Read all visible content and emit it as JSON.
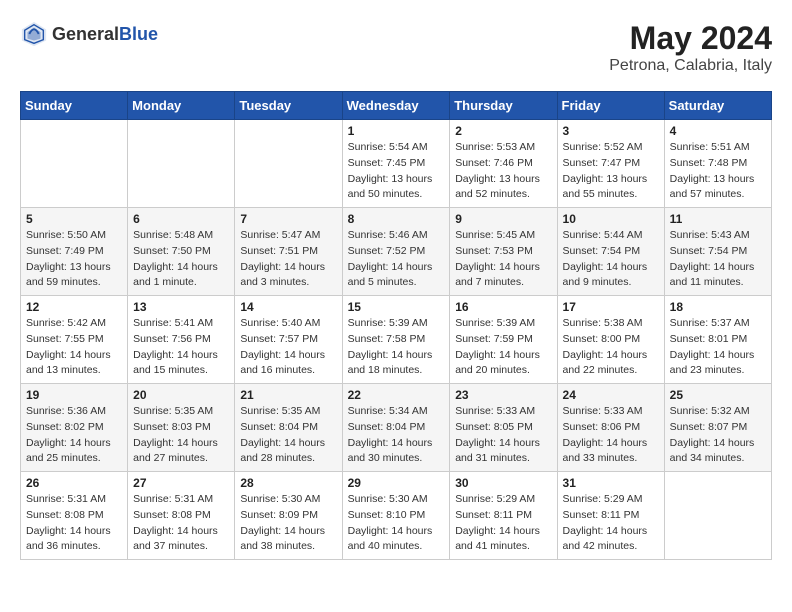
{
  "header": {
    "logo_general": "General",
    "logo_blue": "Blue",
    "month": "May 2024",
    "location": "Petrona, Calabria, Italy"
  },
  "weekdays": [
    "Sunday",
    "Monday",
    "Tuesday",
    "Wednesday",
    "Thursday",
    "Friday",
    "Saturday"
  ],
  "weeks": [
    [
      {
        "day": "",
        "info": ""
      },
      {
        "day": "",
        "info": ""
      },
      {
        "day": "",
        "info": ""
      },
      {
        "day": "1",
        "info": "Sunrise: 5:54 AM\nSunset: 7:45 PM\nDaylight: 13 hours\nand 50 minutes."
      },
      {
        "day": "2",
        "info": "Sunrise: 5:53 AM\nSunset: 7:46 PM\nDaylight: 13 hours\nand 52 minutes."
      },
      {
        "day": "3",
        "info": "Sunrise: 5:52 AM\nSunset: 7:47 PM\nDaylight: 13 hours\nand 55 minutes."
      },
      {
        "day": "4",
        "info": "Sunrise: 5:51 AM\nSunset: 7:48 PM\nDaylight: 13 hours\nand 57 minutes."
      }
    ],
    [
      {
        "day": "5",
        "info": "Sunrise: 5:50 AM\nSunset: 7:49 PM\nDaylight: 13 hours\nand 59 minutes."
      },
      {
        "day": "6",
        "info": "Sunrise: 5:48 AM\nSunset: 7:50 PM\nDaylight: 14 hours\nand 1 minute."
      },
      {
        "day": "7",
        "info": "Sunrise: 5:47 AM\nSunset: 7:51 PM\nDaylight: 14 hours\nand 3 minutes."
      },
      {
        "day": "8",
        "info": "Sunrise: 5:46 AM\nSunset: 7:52 PM\nDaylight: 14 hours\nand 5 minutes."
      },
      {
        "day": "9",
        "info": "Sunrise: 5:45 AM\nSunset: 7:53 PM\nDaylight: 14 hours\nand 7 minutes."
      },
      {
        "day": "10",
        "info": "Sunrise: 5:44 AM\nSunset: 7:54 PM\nDaylight: 14 hours\nand 9 minutes."
      },
      {
        "day": "11",
        "info": "Sunrise: 5:43 AM\nSunset: 7:54 PM\nDaylight: 14 hours\nand 11 minutes."
      }
    ],
    [
      {
        "day": "12",
        "info": "Sunrise: 5:42 AM\nSunset: 7:55 PM\nDaylight: 14 hours\nand 13 minutes."
      },
      {
        "day": "13",
        "info": "Sunrise: 5:41 AM\nSunset: 7:56 PM\nDaylight: 14 hours\nand 15 minutes."
      },
      {
        "day": "14",
        "info": "Sunrise: 5:40 AM\nSunset: 7:57 PM\nDaylight: 14 hours\nand 16 minutes."
      },
      {
        "day": "15",
        "info": "Sunrise: 5:39 AM\nSunset: 7:58 PM\nDaylight: 14 hours\nand 18 minutes."
      },
      {
        "day": "16",
        "info": "Sunrise: 5:39 AM\nSunset: 7:59 PM\nDaylight: 14 hours\nand 20 minutes."
      },
      {
        "day": "17",
        "info": "Sunrise: 5:38 AM\nSunset: 8:00 PM\nDaylight: 14 hours\nand 22 minutes."
      },
      {
        "day": "18",
        "info": "Sunrise: 5:37 AM\nSunset: 8:01 PM\nDaylight: 14 hours\nand 23 minutes."
      }
    ],
    [
      {
        "day": "19",
        "info": "Sunrise: 5:36 AM\nSunset: 8:02 PM\nDaylight: 14 hours\nand 25 minutes."
      },
      {
        "day": "20",
        "info": "Sunrise: 5:35 AM\nSunset: 8:03 PM\nDaylight: 14 hours\nand 27 minutes."
      },
      {
        "day": "21",
        "info": "Sunrise: 5:35 AM\nSunset: 8:04 PM\nDaylight: 14 hours\nand 28 minutes."
      },
      {
        "day": "22",
        "info": "Sunrise: 5:34 AM\nSunset: 8:04 PM\nDaylight: 14 hours\nand 30 minutes."
      },
      {
        "day": "23",
        "info": "Sunrise: 5:33 AM\nSunset: 8:05 PM\nDaylight: 14 hours\nand 31 minutes."
      },
      {
        "day": "24",
        "info": "Sunrise: 5:33 AM\nSunset: 8:06 PM\nDaylight: 14 hours\nand 33 minutes."
      },
      {
        "day": "25",
        "info": "Sunrise: 5:32 AM\nSunset: 8:07 PM\nDaylight: 14 hours\nand 34 minutes."
      }
    ],
    [
      {
        "day": "26",
        "info": "Sunrise: 5:31 AM\nSunset: 8:08 PM\nDaylight: 14 hours\nand 36 minutes."
      },
      {
        "day": "27",
        "info": "Sunrise: 5:31 AM\nSunset: 8:08 PM\nDaylight: 14 hours\nand 37 minutes."
      },
      {
        "day": "28",
        "info": "Sunrise: 5:30 AM\nSunset: 8:09 PM\nDaylight: 14 hours\nand 38 minutes."
      },
      {
        "day": "29",
        "info": "Sunrise: 5:30 AM\nSunset: 8:10 PM\nDaylight: 14 hours\nand 40 minutes."
      },
      {
        "day": "30",
        "info": "Sunrise: 5:29 AM\nSunset: 8:11 PM\nDaylight: 14 hours\nand 41 minutes."
      },
      {
        "day": "31",
        "info": "Sunrise: 5:29 AM\nSunset: 8:11 PM\nDaylight: 14 hours\nand 42 minutes."
      },
      {
        "day": "",
        "info": ""
      }
    ]
  ]
}
